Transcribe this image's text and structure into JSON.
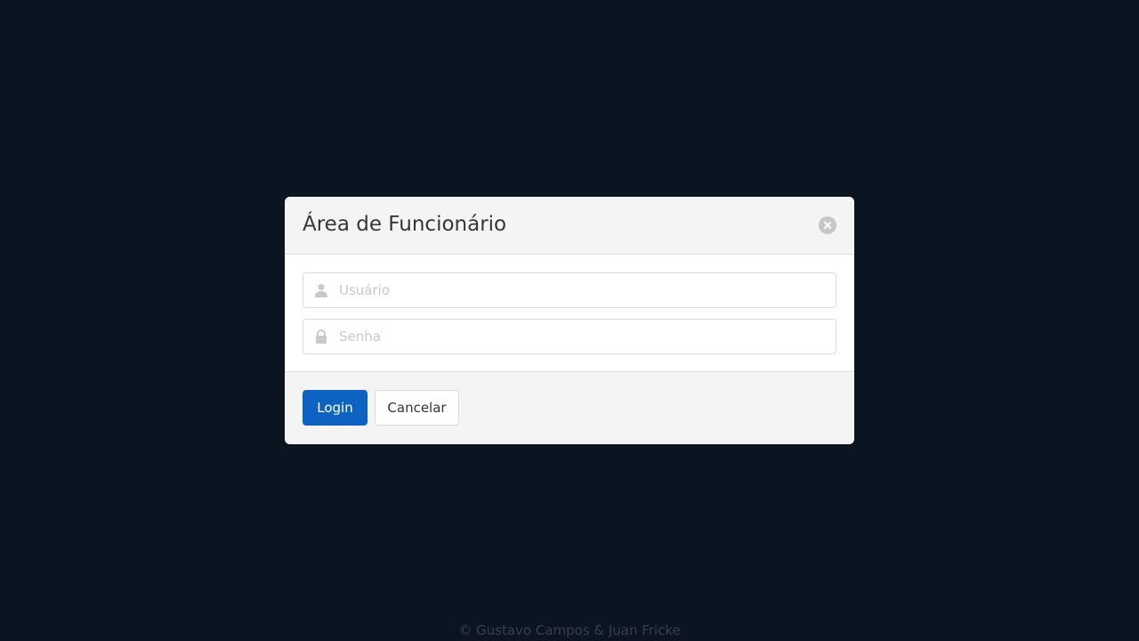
{
  "modal": {
    "title": "Área de Funcionário",
    "close_icon": "close-circle-icon"
  },
  "form": {
    "username": {
      "placeholder": "Usuário",
      "value": "",
      "icon": "user-icon"
    },
    "password": {
      "placeholder": "Senha",
      "value": "",
      "icon": "lock-icon"
    }
  },
  "actions": {
    "login_label": "Login",
    "cancel_label": "Cancelar"
  },
  "footer": {
    "credit": "© Gustavo Campos & Juan Fricke"
  },
  "colors": {
    "page_background": "#0b1522",
    "primary": "#0e62c2",
    "modal_header_bg": "#f4f4f4",
    "placeholder": "#c9c9c9"
  }
}
